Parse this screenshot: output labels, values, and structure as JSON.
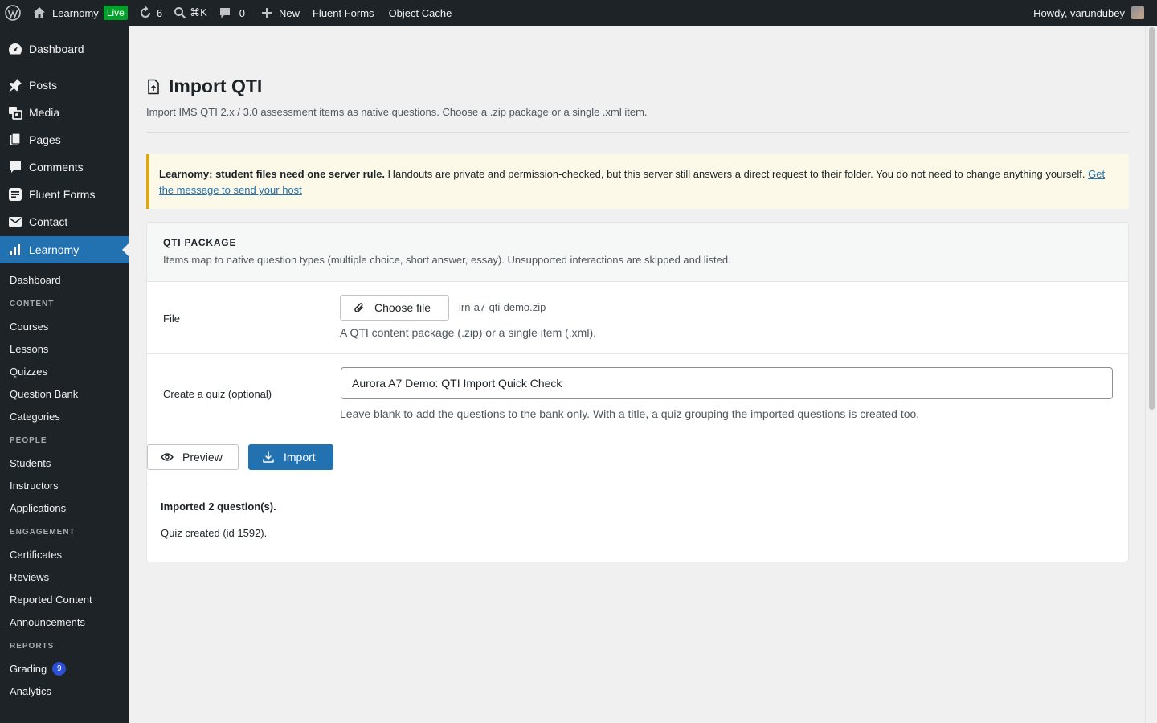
{
  "admin_bar": {
    "site_name": "Learnomy",
    "live_badge": "Live",
    "updates_count": "6",
    "search_shortcut": "⌘K",
    "comments_count": "0",
    "new_label": "New",
    "fluent_forms": "Fluent Forms",
    "object_cache": "Object Cache",
    "howdy": "Howdy, varundubey"
  },
  "sidebar": {
    "top_items": [
      {
        "label": "Dashboard",
        "icon": "dashboard-icon"
      },
      {
        "label": "Posts",
        "icon": "pin-icon"
      },
      {
        "label": "Media",
        "icon": "media-icon"
      },
      {
        "label": "Pages",
        "icon": "pages-icon"
      },
      {
        "label": "Comments",
        "icon": "comment-icon"
      },
      {
        "label": "Fluent Forms",
        "icon": "forms-icon"
      },
      {
        "label": "Contact",
        "icon": "mail-icon"
      },
      {
        "label": "Learnomy",
        "icon": "chart-icon"
      }
    ],
    "sub": {
      "dashboard": "Dashboard",
      "content_heading": "CONTENT",
      "courses": "Courses",
      "lessons": "Lessons",
      "quizzes": "Quizzes",
      "question_bank": "Question Bank",
      "categories": "Categories",
      "people_heading": "PEOPLE",
      "students": "Students",
      "instructors": "Instructors",
      "applications": "Applications",
      "engagement_heading": "ENGAGEMENT",
      "certificates": "Certificates",
      "reviews": "Reviews",
      "reported_content": "Reported Content",
      "announcements": "Announcements",
      "reports_heading": "REPORTS",
      "grading": "Grading",
      "grading_badge": "9",
      "analytics": "Analytics"
    }
  },
  "page": {
    "title": "Import QTI",
    "description": "Import IMS QTI 2.x / 3.0 assessment items as native questions. Choose a .zip package or a single .xml item."
  },
  "notice": {
    "bold": "Learnomy: student files need one server rule.",
    "text": " Handouts are private and permission-checked, but this server still answers a direct request to their folder. You do not need to change anything yourself. ",
    "link": "Get the message to send your host"
  },
  "card": {
    "title": "QTI PACKAGE",
    "subtitle": "Items map to native question types (multiple choice, short answer, essay). Unsupported interactions are skipped and listed.",
    "file_label": "File",
    "choose_file": "Choose file",
    "file_name": "lrn-a7-qti-demo.zip",
    "file_help": "A QTI content package (.zip) or a single item (.xml).",
    "quiz_label": "Create a quiz (optional)",
    "quiz_value": "Aurora A7 Demo: QTI Import Quick Check",
    "quiz_help": "Leave blank to add the questions to the bank only. With a title, a quiz grouping the imported questions is created too.",
    "preview_button": "Preview",
    "import_button": "Import"
  },
  "result": {
    "title": "Imported 2 question(s).",
    "line": "Quiz created (id 1592)."
  }
}
